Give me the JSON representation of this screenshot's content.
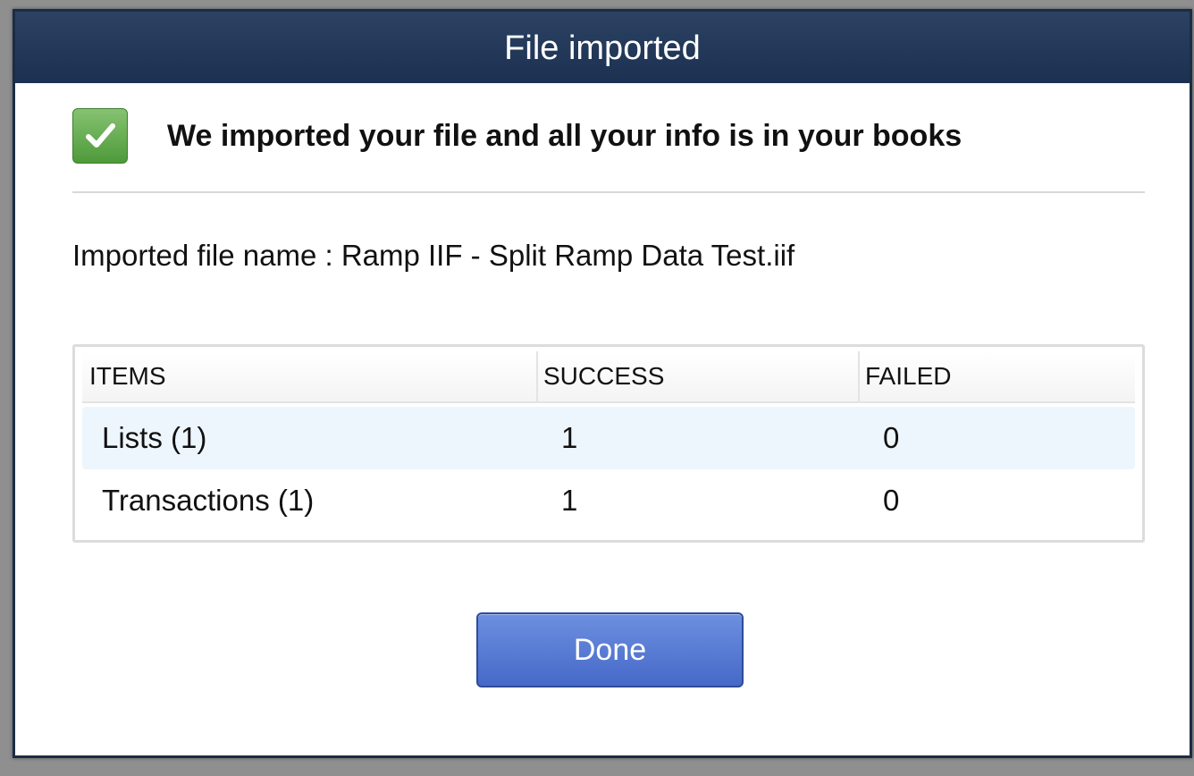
{
  "dialog": {
    "title": "File imported"
  },
  "banner": {
    "icon": "check-icon",
    "message": "We imported your file and all your info is in your books",
    "icon_color": "#5aa846"
  },
  "file": {
    "label": "Imported file name : ",
    "name": "Ramp IIF - Split Ramp Data Test.iif"
  },
  "table": {
    "headers": [
      "ITEMS",
      "SUCCESS",
      "FAILED"
    ],
    "rows": [
      {
        "item": "Lists (1)",
        "success": "1",
        "failed": "0"
      },
      {
        "item": "Transactions (1)",
        "success": "1",
        "failed": "0"
      }
    ]
  },
  "actions": {
    "done_label": "Done",
    "accent_color": "#4a6ccb"
  },
  "colors": {
    "titlebar": "#23395a",
    "row_highlight": "#eef6fd"
  }
}
